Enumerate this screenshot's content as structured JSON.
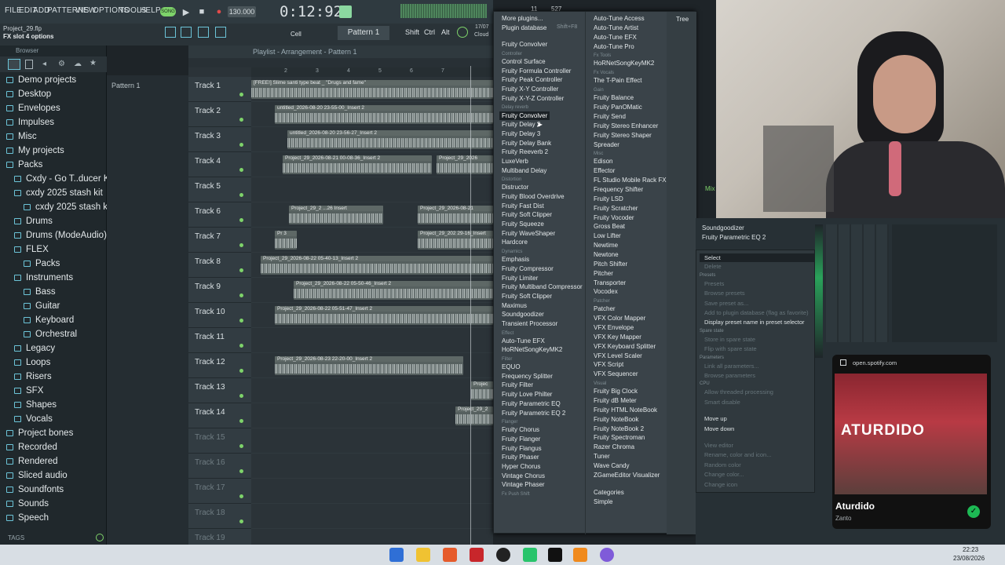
{
  "menu": [
    "FILE",
    "EDIT",
    "ADD",
    "PATTERNS",
    "VIEW",
    "OPTIONS",
    "TOOLS",
    "HELP"
  ],
  "transport": {
    "mode": "SONG",
    "tempo": "130.000",
    "time": "0:12:92",
    "cpu": "11",
    "memory": "527 MB"
  },
  "project": {
    "name": "Project_29.flp",
    "hint": "FX slot 4 options"
  },
  "toolbar": {
    "pattern": "Pattern 1",
    "cell_label": "Cell",
    "shift": "Shift",
    "ctrl": "Ctrl",
    "alt": "Alt",
    "cloud": "Cloud",
    "date_small": "17/07"
  },
  "browser": {
    "title": "Browser",
    "tags": "TAGS",
    "items": [
      "Demo projects",
      "Desktop",
      "Envelopes",
      "Impulses",
      "Misc",
      "My projects",
      "Packs",
      "Cxdy - Go T..ducer Kit)",
      "cxdy 2025 stash kit",
      "cxdy 2025 stash kit",
      "Drums",
      "Drums (ModeAudio)",
      "FLEX",
      "Packs",
      "Instruments",
      "Bass",
      "Guitar",
      "Keyboard",
      "Orchestral",
      "Legacy",
      "Loops",
      "Risers",
      "SFX",
      "Shapes",
      "Vocals",
      "Project bones",
      "Recorded",
      "Rendered",
      "Sliced audio",
      "Soundfonts",
      "Sounds",
      "Speech"
    ]
  },
  "patterns": {
    "item": "Pattern 1"
  },
  "playlist": {
    "title": "Playlist - Arrangement - Pattern 1",
    "ruler": [
      "2",
      "3",
      "4",
      "5",
      "6",
      "7"
    ],
    "tracks": [
      "Track 1",
      "Track 2",
      "Track 3",
      "Track 4",
      "Track 5",
      "Track 6",
      "Track 7",
      "Track 8",
      "Track 9",
      "Track 10",
      "Track 11",
      "Track 12",
      "Track 13",
      "Track 14",
      "Track 15",
      "Track 16",
      "Track 17",
      "Track 18",
      "Track 19"
    ],
    "clips": [
      "[FREE!] Slime santi type beat _ \"Drugs and fame\"",
      "untitled_2026-08-20 23-55-00_Insert 2",
      "untitled_2026-08-20 23-56-27_Insert 2",
      "Project_29_2026-08-21 00-08-36_Insert 2",
      "Project_29_2026",
      "Project_29_2 ...26 Insert",
      "Project_29_2026-08-21",
      "Pr 3",
      "Project_29_202 29-16_Insert",
      "Project_29_2026-08-22 05-40-13_Insert 2",
      "Project_29_2026-08-22 05-50-46_Insert 2",
      "Project_29_2026-08-22 05-51-47_Insert 2",
      "Project_29_2026-08-23 22-20-00_Insert 2",
      "Projec",
      "Project_29_2"
    ]
  },
  "plugin_menu": {
    "col1": [
      {
        "t": "More plugins..."
      },
      {
        "t": "Plugin database",
        "k": "Shift+F8"
      },
      {
        "h": ""
      },
      {
        "t": "Fruity Convolver"
      },
      {
        "h": "Controller"
      },
      {
        "t": "Control Surface"
      },
      {
        "t": "Fruity Formula Controller"
      },
      {
        "t": "Fruity Peak Controller"
      },
      {
        "t": "Fruity X-Y Controller"
      },
      {
        "t": "Fruity X-Y-Z Controller"
      },
      {
        "h": "Delay reverb"
      },
      {
        "t": "Fruity Convolver",
        "sel": true
      },
      {
        "t": "Fruity Delay 2"
      },
      {
        "t": "Fruity Delay 3"
      },
      {
        "t": "Fruity Delay Bank"
      },
      {
        "t": "Fruity Reeverb 2"
      },
      {
        "t": "LuxeVerb"
      },
      {
        "t": "Multiband Delay"
      },
      {
        "h": "Distortion"
      },
      {
        "t": "Distructor"
      },
      {
        "t": "Fruity Blood Overdrive"
      },
      {
        "t": "Fruity Fast Dist"
      },
      {
        "t": "Fruity Soft Clipper"
      },
      {
        "t": "Fruity Squeeze"
      },
      {
        "t": "Fruity WaveShaper"
      },
      {
        "t": "Hardcore"
      },
      {
        "h": "Dynamics"
      },
      {
        "t": "Emphasis"
      },
      {
        "t": "Fruity Compressor"
      },
      {
        "t": "Fruity Limiter"
      },
      {
        "t": "Fruity Multiband Compressor"
      },
      {
        "t": "Fruity Soft Clipper"
      },
      {
        "t": "Maximus"
      },
      {
        "t": "Soundgoodizer"
      },
      {
        "t": "Transient Processor"
      },
      {
        "h": "Effect"
      },
      {
        "t": "Auto-Tune EFX"
      },
      {
        "t": "HoRNetSongKeyMK2"
      },
      {
        "h": "Filter"
      },
      {
        "t": "EQUO"
      },
      {
        "t": "Frequency Splitter"
      },
      {
        "t": "Fruity Filter"
      },
      {
        "t": "Fruity Love Philter"
      },
      {
        "t": "Fruity Parametric EQ"
      },
      {
        "t": "Fruity Parametric EQ 2"
      },
      {
        "h": "Flanger"
      },
      {
        "t": "Fruity Chorus"
      },
      {
        "t": "Fruity Flanger"
      },
      {
        "t": "Fruity Flangus"
      },
      {
        "t": "Fruity Phaser"
      },
      {
        "t": "Hyper Chorus"
      },
      {
        "t": "Vintage Chorus"
      },
      {
        "t": "Vintage Phaser"
      },
      {
        "h": "Fx Push Shift"
      }
    ],
    "col2": [
      {
        "t": "Auto-Tune Access"
      },
      {
        "t": "Auto-Tune Artist"
      },
      {
        "t": "Auto-Tune EFX"
      },
      {
        "t": "Auto-Tune Pro"
      },
      {
        "h": "Fx Tools"
      },
      {
        "t": "HoRNetSongKeyMK2"
      },
      {
        "h": "Fx Vocals"
      },
      {
        "t": "The T-Pain Effect"
      },
      {
        "h": "Gain"
      },
      {
        "t": "Fruity Balance"
      },
      {
        "t": "Fruity PanOMatic"
      },
      {
        "t": "Fruity Send"
      },
      {
        "t": "Fruity Stereo Enhancer"
      },
      {
        "t": "Fruity Stereo Shaper"
      },
      {
        "t": "Spreader"
      },
      {
        "h": "Misc"
      },
      {
        "t": "Edison"
      },
      {
        "t": "Effector"
      },
      {
        "t": "FL Studio Mobile Rack FX"
      },
      {
        "t": "Frequency Shifter"
      },
      {
        "t": "Fruity LSD"
      },
      {
        "t": "Fruity Scratcher"
      },
      {
        "t": "Fruity Vocoder"
      },
      {
        "t": "Gross Beat"
      },
      {
        "t": "Low Lifter"
      },
      {
        "t": "Newtime"
      },
      {
        "t": "Newtone"
      },
      {
        "t": "Pitch Shifter"
      },
      {
        "t": "Pitcher"
      },
      {
        "t": "Transporter"
      },
      {
        "t": "Vocodex"
      },
      {
        "h": "Patcher"
      },
      {
        "t": "Patcher"
      },
      {
        "t": "VFX Color Mapper"
      },
      {
        "t": "VFX Envelope"
      },
      {
        "t": "VFX Key Mapper"
      },
      {
        "t": "VFX Keyboard Splitter"
      },
      {
        "t": "VFX Level Scaler"
      },
      {
        "t": "VFX Script"
      },
      {
        "t": "VFX Sequencer"
      },
      {
        "h": "Visual"
      },
      {
        "t": "Fruity Big Clock"
      },
      {
        "t": "Fruity dB Meter"
      },
      {
        "t": "Fruity HTML NoteBook"
      },
      {
        "t": "Fruity NoteBook"
      },
      {
        "t": "Fruity NoteBook 2"
      },
      {
        "t": "Fruity Spectroman"
      },
      {
        "t": "Razer Chroma"
      },
      {
        "t": "Tuner"
      },
      {
        "t": "Wave Candy"
      },
      {
        "t": "ZGameEditor Visualizer"
      },
      {
        "h": ""
      },
      {
        "t": "Categories"
      },
      {
        "t": "Simple"
      }
    ],
    "col3": [
      {
        "t": "Tree"
      }
    ]
  },
  "mixer": {
    "slots": [
      "Soundgoodizer",
      "Fruity Parametric EQ 2"
    ],
    "header": "Mix",
    "context": [
      {
        "t": "Select",
        "dim": false
      },
      {
        "t": "Delete",
        "dim": true
      },
      {
        "h": "Presets"
      },
      {
        "t": "Presets",
        "dim": true
      },
      {
        "t": "Browse presets",
        "dim": true
      },
      {
        "t": "Save preset as...",
        "dim": true
      },
      {
        "t": "Add to plugin database (flag as favorite)",
        "dim": true
      },
      {
        "t": "Display preset name in preset selector",
        "dim": false
      },
      {
        "h": "Spare state"
      },
      {
        "t": "Store in spare state",
        "dim": true
      },
      {
        "t": "Flip with spare state",
        "dim": true
      },
      {
        "h": "Parameters"
      },
      {
        "t": "Link all parameters...",
        "dim": true
      },
      {
        "t": "Browse parameters",
        "dim": true
      },
      {
        "h": "CPU"
      },
      {
        "t": "Allow threaded processing",
        "dim": true
      },
      {
        "t": "Smart disable",
        "dim": true
      },
      {
        "h": ""
      },
      {
        "t": "Move up",
        "dim": false
      },
      {
        "t": "Move down",
        "dim": false
      },
      {
        "h": ""
      },
      {
        "t": "View editor",
        "dim": true
      },
      {
        "t": "Rename, color and icon...",
        "dim": true
      },
      {
        "t": "Random color",
        "dim": true
      },
      {
        "t": "Change color...",
        "dim": true
      },
      {
        "t": "Change icon",
        "dim": true
      }
    ]
  },
  "spotify": {
    "site": "open.spotify.com",
    "cover_text": "ATURDIDO",
    "track": "Aturdido",
    "artist": "Zanto"
  },
  "taskbar": {
    "time": "22:23",
    "date": "23/08/2026"
  },
  "colors": {
    "accent": "#7ed36a",
    "menu_bg": "#3a4349",
    "selected": "#1c2226",
    "clip": "#56605f",
    "teal": "#6cc4d8"
  }
}
